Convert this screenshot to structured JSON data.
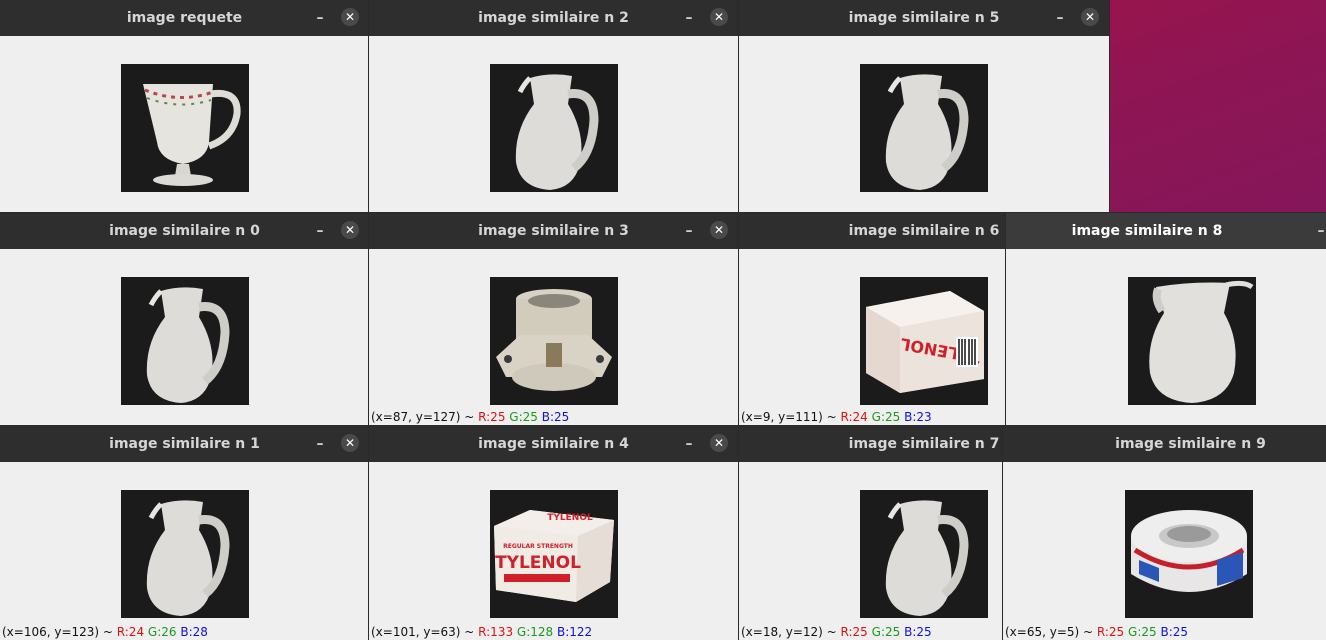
{
  "windows": [
    {
      "id": "requete",
      "title": "image requete",
      "thumbnail": "mug"
    },
    {
      "id": "n2",
      "title": "image similaire n 2",
      "thumbnail": "pitcher"
    },
    {
      "id": "n5",
      "title": "image similaire n 5",
      "thumbnail": "pitcher"
    },
    {
      "id": "n0",
      "title": "image similaire n 0",
      "thumbnail": "pitcher"
    },
    {
      "id": "n3",
      "title": "image similaire n 3",
      "thumbnail": "lamp-socket",
      "status": {
        "coords": "(x=87, y=127) ~ ",
        "r": "R:25",
        "g": "G:25",
        "b": "B:25"
      }
    },
    {
      "id": "n6",
      "title": "image similaire n 6",
      "thumbnail": "tylenol-box-rotated",
      "status": {
        "coords": "(x=9, y=111) ~ ",
        "r": "R:24",
        "g": "G:25",
        "b": "B:23"
      }
    },
    {
      "id": "n8",
      "title": "image similaire n 8",
      "thumbnail": "pitcher",
      "active": true
    },
    {
      "id": "n1",
      "title": "image similaire n 1",
      "thumbnail": "pitcher",
      "status": {
        "coords": "(x=106, y=123) ~ ",
        "r": "R:24",
        "g": "G:26",
        "b": "B:28"
      }
    },
    {
      "id": "n4",
      "title": "image similaire n 4",
      "thumbnail": "tylenol-box",
      "status": {
        "coords": "(x=101, y=63) ~ ",
        "r": "R:133",
        "g": "G:128",
        "b": "B:122"
      }
    },
    {
      "id": "n7",
      "title": "image similaire n 7",
      "thumbnail": "pitcher",
      "status": {
        "coords": "(x=18, y=12) ~ ",
        "r": "R:25",
        "g": "G:25",
        "b": "B:25"
      }
    },
    {
      "id": "n9",
      "title": "image similaire n 9",
      "thumbnail": "tape-roll",
      "status": {
        "coords": "(x=65, y=5) ~ ",
        "r": "R:25",
        "g": "G:25",
        "b": "B:25"
      }
    }
  ],
  "controls": {
    "minimize_glyph": "–",
    "close_glyph": "✕"
  },
  "thumb_text": {
    "tylenol": "TYLENOL",
    "regular_strength": "REGULAR STRENGTH"
  },
  "colors": {
    "titlebar": "#2e2e2e",
    "window_bg": "#efefef",
    "r": "#e01010",
    "g": "#1a9a1a",
    "b": "#1010e0"
  }
}
